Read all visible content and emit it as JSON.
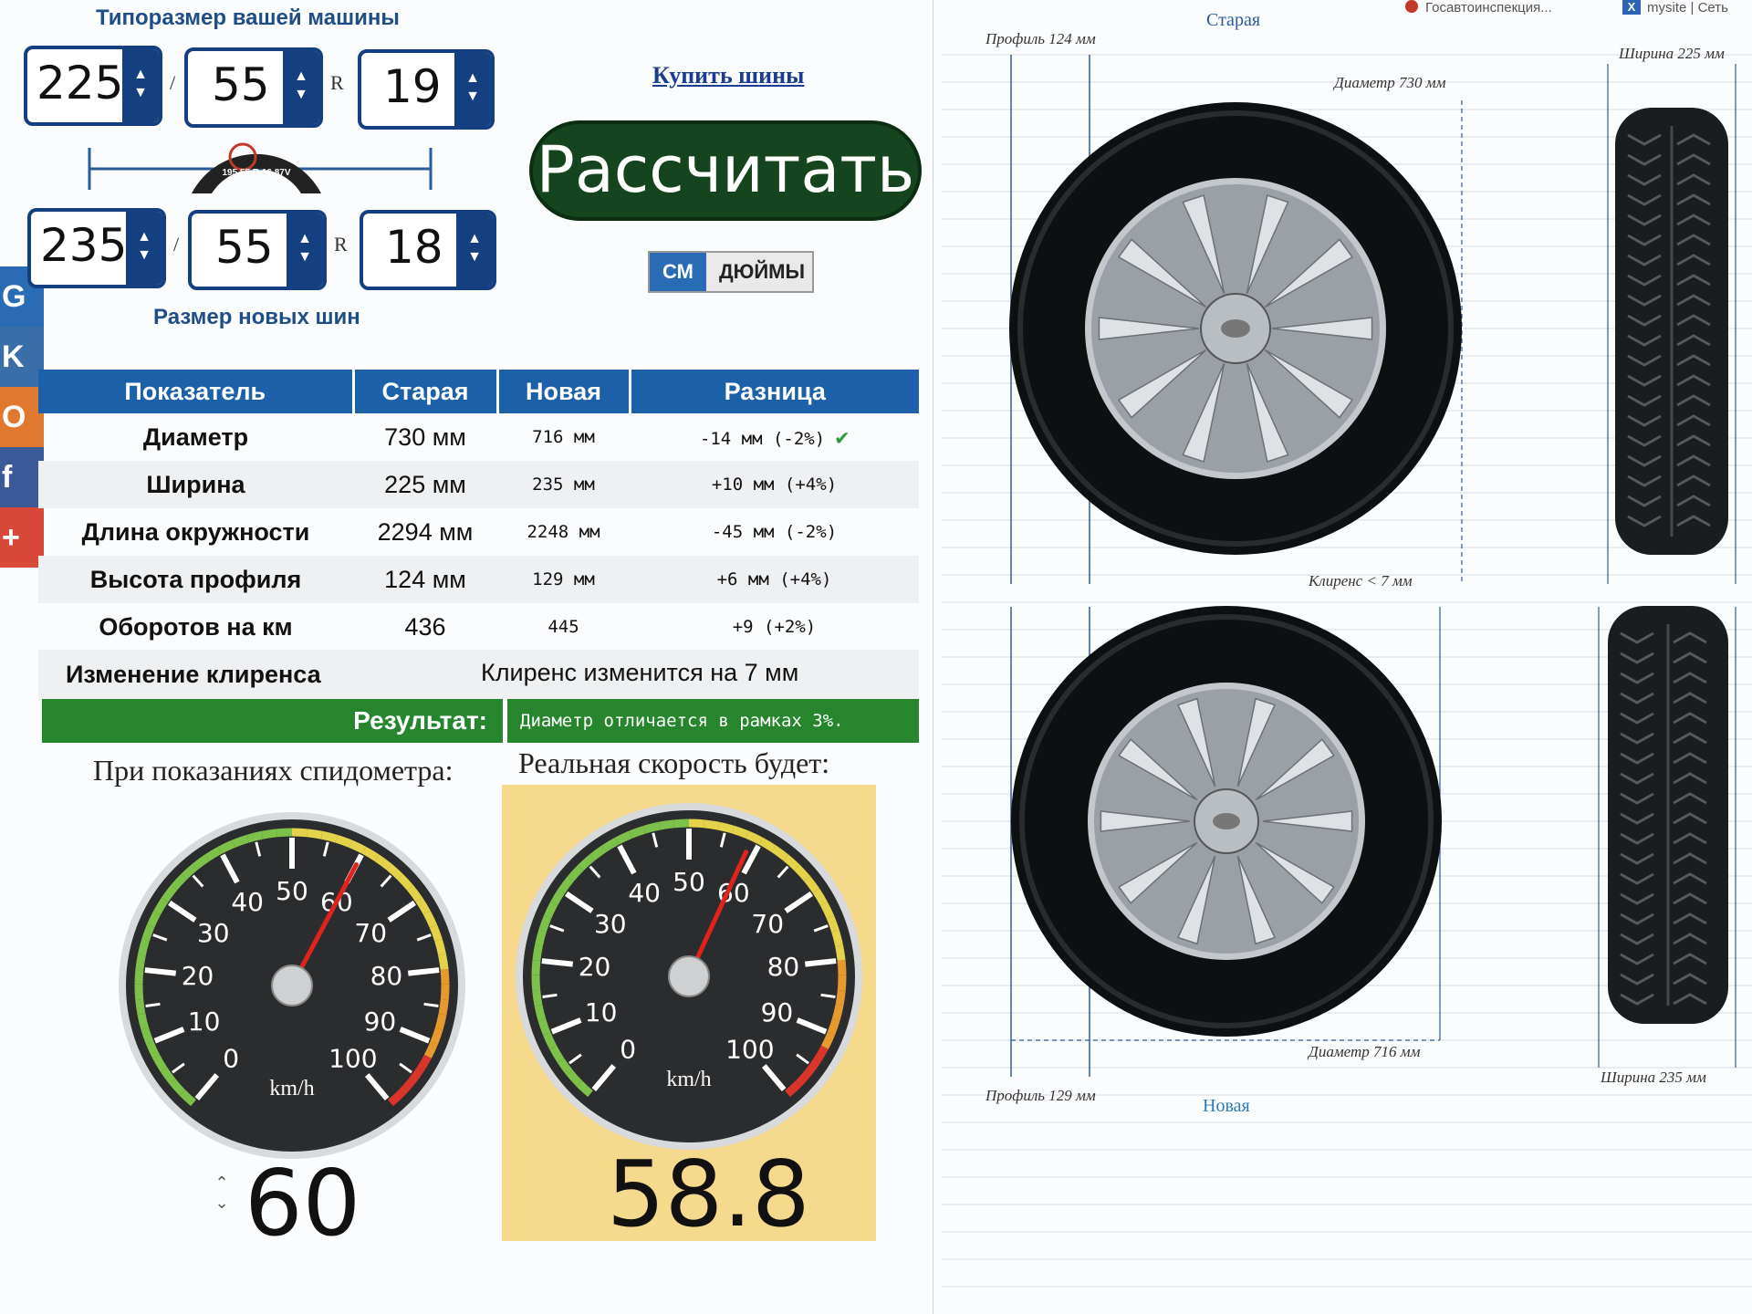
{
  "top_fragment": {
    "left": "Госавтоинспекция...",
    "right": "mysite | Сеть"
  },
  "social_colors": [
    "#2a6bb5",
    "#3a6ea8",
    "#e0782e",
    "#3b5b98",
    "#d8493a"
  ],
  "social_labels": [
    "G",
    "K",
    "O",
    "f",
    "+"
  ],
  "old_size": {
    "heading": "Типоразмер вашей машины",
    "width": "225",
    "profile": "55",
    "rim": "19"
  },
  "new_size": {
    "heading": "Размер новых шин",
    "width": "235",
    "profile": "55",
    "rim": "18"
  },
  "separators": {
    "slash": "/",
    "r": "R"
  },
  "tire_marking": "195 55 R 16 87V",
  "buy_link": "Купить шины",
  "calc_button": "Рассчитать",
  "units": {
    "cm": "СМ",
    "inches": "ДЮЙМЫ"
  },
  "table": {
    "headers": [
      "Показатель",
      "Старая",
      "Новая",
      "Разница"
    ],
    "rows": [
      {
        "label": "Диаметр",
        "old": "730 мм",
        "new": "716 мм",
        "diff": "-14 мм (-2%)"
      },
      {
        "label": "Ширина",
        "old": "225 мм",
        "new": "235 мм",
        "diff": "+10 мм (+4%)"
      },
      {
        "label": "Длина окружности",
        "old": "2294 мм",
        "new": "2248 мм",
        "diff": "-45 мм (-2%)"
      },
      {
        "label": "Высота профиля",
        "old": "124 мм",
        "new": "129 мм",
        "diff": "+6 мм (+4%)"
      },
      {
        "label": "Оборотов на км",
        "old": "436",
        "new": "445",
        "diff": "+9 (+2%)"
      }
    ]
  },
  "clearance": {
    "label": "Изменение клиренса",
    "value": "Клиренс изменится на 7 мм"
  },
  "result": {
    "label": "Результат:",
    "value": "Диаметр отличается в рамках 3%."
  },
  "speedometer": {
    "label_shown": "При показаниях спидометра:",
    "label_real": "Реальная скорость будет:",
    "shown_value": "60",
    "real_value": "58.8",
    "unit": "km/h",
    "ticks": [
      "0",
      "10",
      "20",
      "30",
      "40",
      "50",
      "60",
      "70",
      "80",
      "90",
      "100"
    ],
    "needle_shown": 60,
    "needle_real": 58.8
  },
  "tire_diagram": {
    "old_title": "Старая",
    "new_title": "Новая",
    "old_profile": "Профиль 124 мм",
    "old_width": "Ширина 225 мм",
    "old_diameter": "Диаметр 730 мм",
    "clearance": "Клиренс < 7 мм",
    "new_diameter": "Диаметр 716 мм",
    "new_profile": "Профиль 129 мм",
    "new_width": "Ширина 235 мм"
  }
}
